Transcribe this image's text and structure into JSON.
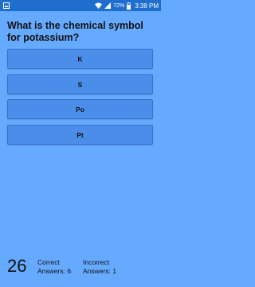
{
  "status_bar": {
    "battery": "72%",
    "time": "3:38 PM",
    "icons": [
      "image-icon",
      "wifi-icon",
      "signal-icon",
      "battery-icon"
    ]
  },
  "quiz": {
    "question": "What is the chemical symbol for potassium?",
    "answers": [
      "K",
      "S",
      "Po",
      "Pt"
    ]
  },
  "footer": {
    "counter": "26",
    "correct_label": "Correct",
    "correct_value": "Answers: 6",
    "incorrect_label": "Incorrect",
    "incorrect_value": "Answers: 1"
  },
  "colors": {
    "background": "#66aaff",
    "status_bar": "#1e6fcd",
    "button": "#4a8eea"
  }
}
